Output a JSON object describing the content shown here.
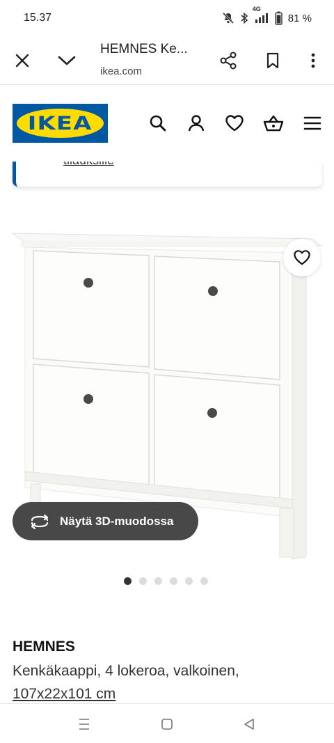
{
  "status_bar": {
    "time": "15.37",
    "network": "4G",
    "battery": "81 %",
    "icons": [
      "mute-icon",
      "bluetooth-icon",
      "signal-icon",
      "battery-icon"
    ]
  },
  "browser": {
    "title": "HEMNES Ke...",
    "url": "ikea.com",
    "icons": [
      "close-icon",
      "chevron-down-icon",
      "share-icon",
      "bookmark-icon",
      "more-vertical-icon"
    ]
  },
  "header": {
    "logo_text": "IKEA",
    "brand_colors": {
      "blue": "#0058a3",
      "yellow": "#ffdb00"
    },
    "icons": [
      "search-icon",
      "user-icon",
      "heart-icon",
      "cart-icon",
      "menu-icon"
    ]
  },
  "notice": {
    "text": "tilauksille"
  },
  "product": {
    "view_3d_label": "Näytä 3D-muodossa",
    "name": "HEMNES",
    "description": "Kenkäkaappi, 4 lokeroa, valkoinen,",
    "size": "107x22x101 cm",
    "carousel": {
      "count": 6,
      "active_index": 0
    }
  },
  "system_nav": {
    "icons": [
      "recent-apps-icon",
      "home-icon",
      "back-icon"
    ]
  }
}
